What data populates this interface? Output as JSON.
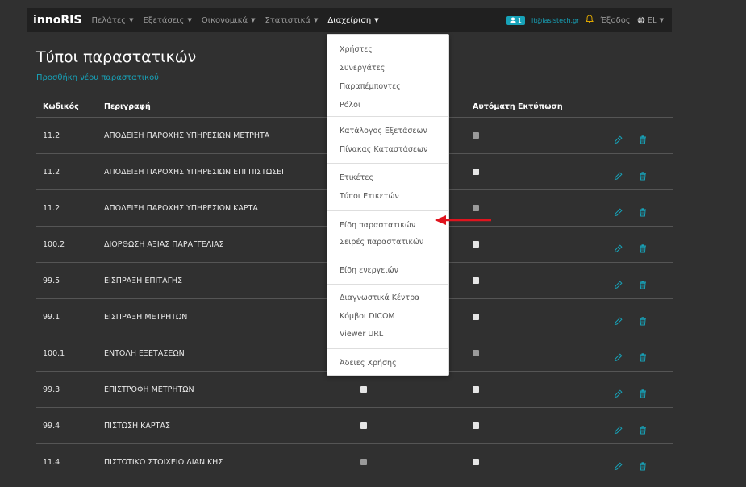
{
  "navbar": {
    "brand": "innoRIS",
    "items": [
      {
        "label": "Πελάτες",
        "active": false
      },
      {
        "label": "Εξετάσεις",
        "active": false
      },
      {
        "label": "Οικονομικά",
        "active": false
      },
      {
        "label": "Στατιστικά",
        "active": false
      },
      {
        "label": "Διαχείριση",
        "active": true
      }
    ],
    "user_count": "1",
    "user_email": "it@iasistech.gr",
    "exit": "Έξοδος",
    "lang": "EL"
  },
  "page": {
    "title": "Τύποι παραστατικών",
    "add_link": "Προσθήκη νέου παραστατικού"
  },
  "table": {
    "headers": {
      "code": "Κωδικός",
      "description": "Περιγραφή",
      "auto_print": "Αυτόματη Εκτύπωση"
    },
    "rows": [
      {
        "code": "11.2",
        "description": "ΑΠΟΔΕΙΞΗ ΠΑΡΟΧΗΣ ΥΠΗΡΕΣΙΩΝ ΜΕΤΡΗΤΑ",
        "check1": true,
        "check2": true
      },
      {
        "code": "11.2",
        "description": "ΑΠΟΔΕΙΞΗ ΠΑΡΟΧΗΣ ΥΠΗΡΕΣΙΩΝ ΕΠΙ ΠΙΣΤΩΣΕΙ",
        "check1": true,
        "check2": false
      },
      {
        "code": "11.2",
        "description": "ΑΠΟΔΕΙΞΗ ΠΑΡΟΧΗΣ ΥΠΗΡΕΣΙΩΝ ΚΑΡΤΑ",
        "check1": true,
        "check2": true
      },
      {
        "code": "100.2",
        "description": "ΔΙΟΡΘΩΣΗ ΑΞΙΑΣ ΠΑΡΑΓΓΕΛΙΑΣ",
        "check1": false,
        "check2": false
      },
      {
        "code": "99.5",
        "description": "ΕΙΣΠΡΑΞΗ ΕΠΙΤΑΓΗΣ",
        "check1": false,
        "check2": false
      },
      {
        "code": "99.1",
        "description": "ΕΙΣΠΡΑΞΗ ΜΕΤΡΗΤΩΝ",
        "check1": false,
        "check2": false
      },
      {
        "code": "100.1",
        "description": "ΕΝΤΟΛΗ ΕΞΕΤΑΣΕΩΝ",
        "check1": false,
        "check2": true
      },
      {
        "code": "99.3",
        "description": "ΕΠΙΣΤΡΟΦΗ ΜΕΤΡΗΤΩΝ",
        "check1": false,
        "check2": false
      },
      {
        "code": "99.4",
        "description": "ΠΙΣΤΩΣΗ ΚΑΡΤΑΣ",
        "check1": false,
        "check2": false
      },
      {
        "code": "11.4",
        "description": "ΠΙΣΤΩΤΙΚΟ ΣΤΟΙΧΕΙΟ ΛΙΑΝΙΚΗΣ",
        "check1": true,
        "check2": false
      }
    ]
  },
  "dropdown": {
    "items": [
      "Χρήστες",
      "Συνεργάτες",
      "Παραπέμποντες",
      "Ρόλοι",
      "Κατάλογος Εξετάσεων",
      "Πίνακας Καταστάσεων",
      "Ετικέτες",
      "Τύποι Ετικετών",
      "Είδη παραστατικών",
      "Σειρές παραστατικών",
      "Είδη ενεργειών",
      "Διαγνωστικά Κέντρα",
      "Κόμβοι DICOM",
      "Viewer URL",
      "Άδειες Χρήσης"
    ]
  },
  "colors": {
    "accent": "#17a2b8",
    "arrow": "#e0141e",
    "background": "#303030",
    "navbar": "#202020"
  },
  "icons": {
    "edit": "pencil-icon",
    "delete": "trash-icon",
    "user": "user-icon",
    "notification": "bell-icon",
    "language": "globe-icon"
  }
}
